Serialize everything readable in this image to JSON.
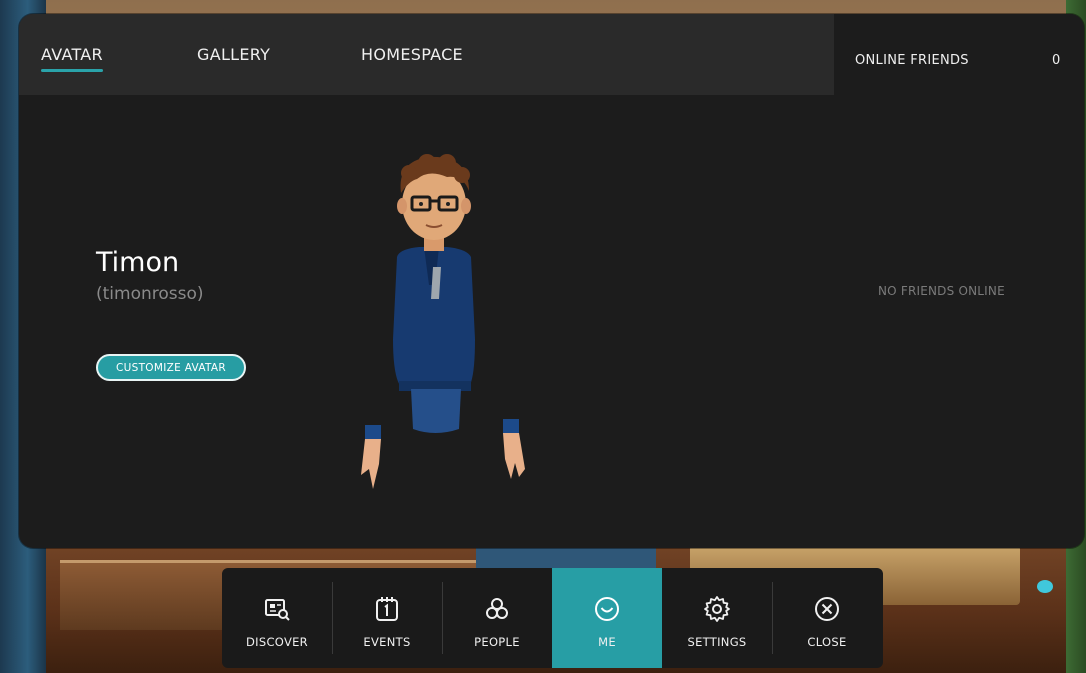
{
  "tabs": [
    {
      "label": "AVATAR",
      "active": true
    },
    {
      "label": "GALLERY",
      "active": false
    },
    {
      "label": "HOMESPACE",
      "active": false
    }
  ],
  "friends": {
    "title": "ONLINE FRIENDS",
    "count": "0",
    "empty_message": "NO FRIENDS ONLINE"
  },
  "profile": {
    "display_name": "Timon",
    "username": "(timonrosso)",
    "customize_label": "CUSTOMIZE AVATAR"
  },
  "dock": [
    {
      "label": "DISCOVER",
      "icon": "discover-icon",
      "active": false
    },
    {
      "label": "EVENTS",
      "icon": "calendar-icon",
      "active": false
    },
    {
      "label": "PEOPLE",
      "icon": "people-icon",
      "active": false
    },
    {
      "label": "ME",
      "icon": "smiley-icon",
      "active": true
    },
    {
      "label": "SETTINGS",
      "icon": "gear-icon",
      "active": false
    },
    {
      "label": "CLOSE",
      "icon": "close-icon",
      "active": false
    }
  ],
  "colors": {
    "accent": "#279ea5",
    "panel_bg": "#1c1c1c",
    "tabbar_bg": "#2a2a2a"
  }
}
